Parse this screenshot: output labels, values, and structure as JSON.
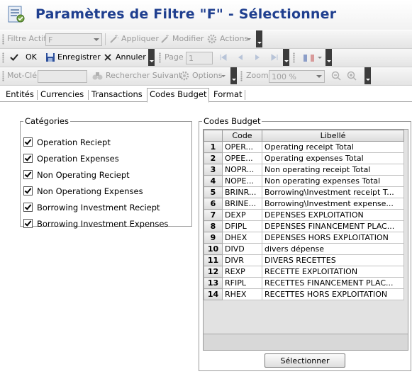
{
  "window": {
    "title": "Paramètres de Filtre \"F\" - Sélectionner"
  },
  "toolbar1": {
    "filter_label": "Filtre Actif",
    "filter_value": "F",
    "apply_label": "Appliquer",
    "modify_label": "Modifier",
    "actions_label": "Actions"
  },
  "toolbar2": {
    "ok_label": "OK",
    "save_label": "Enregistrer",
    "cancel_label": "Annuler",
    "page_label": "Page",
    "page_value": "1"
  },
  "toolbar3": {
    "keyword_label": "Mot-Clé",
    "keyword_value": "",
    "search_next_label": "Rechercher Suivant",
    "options_label": "Options",
    "zoom_label": "Zoom",
    "zoom_value": "100 %"
  },
  "tabs": [
    "Entités",
    "Currencies",
    "Transactions",
    "Codes Budget",
    "Format"
  ],
  "active_tab": "Codes Budget",
  "categories": {
    "legend": "Catégories",
    "items": [
      {
        "label": "Operation Reciept",
        "checked": true
      },
      {
        "label": "Operation Expenses",
        "checked": true
      },
      {
        "label": "Non Operating Reciept",
        "checked": true
      },
      {
        "label": "Non Operationg Expenses",
        "checked": true
      },
      {
        "label": "Borrowing Investment Reciept",
        "checked": true
      },
      {
        "label": "Borrowing Investment Expenses",
        "checked": true
      }
    ]
  },
  "codes_budget": {
    "legend": "Codes Budget",
    "columns": [
      "Code",
      "Libellé"
    ],
    "rows": [
      {
        "num": "1",
        "code": "OPER...",
        "libelle": "Operating receipt Total"
      },
      {
        "num": "2",
        "code": "OPEE...",
        "libelle": "Operating expenses Total"
      },
      {
        "num": "3",
        "code": "NOPR...",
        "libelle": "Non operating receipt Total"
      },
      {
        "num": "4",
        "code": "NOPE...",
        "libelle": "Non operating expenses Total"
      },
      {
        "num": "5",
        "code": "BRINR...",
        "libelle": "Borrowing\\Investment receipt T..."
      },
      {
        "num": "6",
        "code": "BRINE...",
        "libelle": "Borrowing\\Investment expense..."
      },
      {
        "num": "7",
        "code": "DEXP",
        "libelle": "DEPENSES EXPLOITATION"
      },
      {
        "num": "8",
        "code": "DFIPL",
        "libelle": "DEPENSES FINANCEMENT PLAC..."
      },
      {
        "num": "9",
        "code": "DHEX",
        "libelle": "DEPENSES HORS EXPLOITATION"
      },
      {
        "num": "10",
        "code": "DIVD",
        "libelle": "divers dépense"
      },
      {
        "num": "11",
        "code": "DIVR",
        "libelle": "DIVERS RECETTES"
      },
      {
        "num": "12",
        "code": "REXP",
        "libelle": "RECETTE EXPLOITATION"
      },
      {
        "num": "13",
        "code": "RFIPL",
        "libelle": "RECETTES FINANCEMENT PLAC..."
      },
      {
        "num": "14",
        "code": "RHEX",
        "libelle": "RECETTES HORS EXPLOITATION"
      }
    ]
  },
  "select_button": "Sélectionner",
  "icons": {
    "window": "settings-form-icon",
    "apply": "magic-wand-icon",
    "modify": "magic-wand-icon",
    "actions": "gear-icon",
    "ok": "checkmark-icon",
    "save": "floppy-disk-icon",
    "cancel": "x-icon",
    "first": "first-page-icon",
    "prev": "previous-page-icon",
    "next": "next-page-icon",
    "last": "last-page-icon",
    "flag": "french-flag-icon",
    "search": "binoculars-icon",
    "options": "gear-icon",
    "zoom_out": "zoom-out-icon",
    "zoom_in": "zoom-in-icon"
  }
}
